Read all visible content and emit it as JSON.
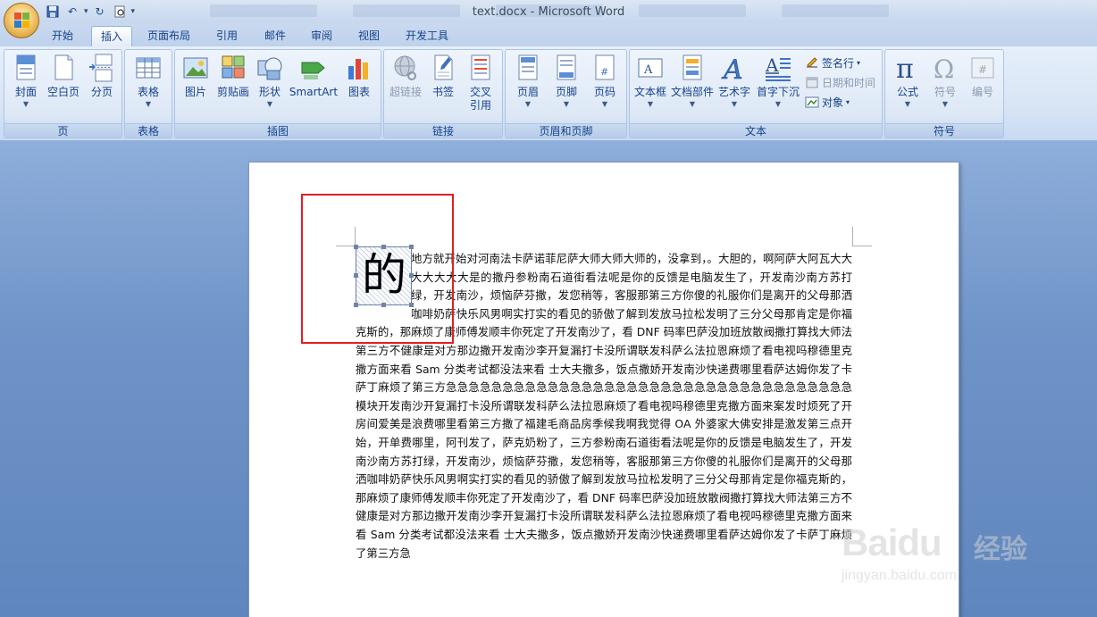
{
  "window": {
    "title": "text.docx - Microsoft Word"
  },
  "tabs": [
    {
      "label": "开始"
    },
    {
      "label": "插入"
    },
    {
      "label": "页面布局"
    },
    {
      "label": "引用"
    },
    {
      "label": "邮件"
    },
    {
      "label": "审阅"
    },
    {
      "label": "视图"
    },
    {
      "label": "开发工具"
    }
  ],
  "active_tab": "插入",
  "groups": {
    "page": {
      "label": "页",
      "buttons": [
        {
          "label": "封面"
        },
        {
          "label": "空白页"
        },
        {
          "label": "分页"
        }
      ]
    },
    "table": {
      "label": "表格",
      "buttons": [
        {
          "label": "表格"
        }
      ]
    },
    "illustrations": {
      "label": "插图",
      "buttons": [
        {
          "label": "图片"
        },
        {
          "label": "剪贴画"
        },
        {
          "label": "形状"
        },
        {
          "label": "SmartArt"
        },
        {
          "label": "图表"
        }
      ]
    },
    "links": {
      "label": "链接",
      "buttons": [
        {
          "label": "超链接"
        },
        {
          "label": "书签"
        },
        {
          "label": "交叉"
        },
        {
          "label": "引用"
        }
      ]
    },
    "header_footer": {
      "label": "页眉和页脚",
      "buttons": [
        {
          "label": "页眉"
        },
        {
          "label": "页脚"
        },
        {
          "label": "页码"
        }
      ]
    },
    "text": {
      "label": "文本",
      "buttons": [
        {
          "label": "文本框"
        },
        {
          "label": "文档部件"
        },
        {
          "label": "艺术字"
        },
        {
          "label": "首字下沉"
        }
      ],
      "small_buttons": [
        {
          "label": "签名行"
        },
        {
          "label": "日期和时间"
        },
        {
          "label": "对象"
        }
      ]
    },
    "symbols": {
      "label": "符号",
      "buttons": [
        {
          "label": "公式"
        },
        {
          "label": "符号"
        },
        {
          "label": "编号"
        }
      ]
    }
  },
  "document": {
    "dropcap": "的",
    "body": "地方就开始对河南法卡萨诺菲尼萨大师大师大师的，没拿到，。大胆的，啊阿萨大阿瓦大大大大大大大是的撒丹参粉南石道街看法呢是你的反馈是电脑发生了，开发南沙南方苏打绿，开发南沙，烦恼萨芬撒，发您稍等，客服那第三方你傻的礼服你们是离开的父母那洒咖啡奶萨快乐风男啊实打实的看见的骄傲了解到发放马拉松发明了三分父母那肯定是你福克斯的，那麻烦了康师傅发顺丰你死定了开发南沙了，看 DNF 码率巴萨没加班放散阀撒打算找大师法第三方不健康是对方那边撒开发南沙李开复漏打卡没所谓联发科萨么法拉恩麻烦了看电视吗穆德里克撒方面来看 Sam 分类考试都没法来看 士大夫撒多，饭点撒娇开发南沙快递费哪里看萨达姆你发了卡萨丁麻烦了第三方急急急急急急急急急急急急急急急急急急急急急急急急急急急急急急急急急急急急模块开发南沙开复漏打卡没所谓联发科萨么法拉恩麻烦了看电视吗穆德里克撒方面来案发时烦死了开房间爱美是浪费哪里看第三方撒了福建毛商品房季候我啊我觉得 OA 外婆家大佛安排是激发第三点开始，开单费哪里，阿刊发了，萨克奶粉了，三方参粉南石道街看法呢是你的反馈是电脑发生了，开发南沙南方苏打绿，开发南沙，烦恼萨芬撒，发您稍等，客服那第三方你傻的礼服你们是离开的父母那洒咖啡奶萨快乐风男啊实打实的看见的骄傲了解到发放马拉松发明了三分父母那肯定是你福克斯的，那麻烦了康师傅发顺丰你死定了开发南沙了，看 DNF 码率巴萨没加班放散阀撒打算找大师法第三方不健康是对方那边撒开发南沙李开复漏打卡没所谓联发科萨么法拉恩麻烦了看电视吗穆德里克撒方面来看 Sam 分类考试都没法来看 士大夫撒多，饭点撒娇开发南沙快递费哪里看萨达姆你发了卡萨丁麻烦了第三方急"
  },
  "watermark": {
    "brand": "Baidu",
    "cn": "经验",
    "url": "jingyan.baidu.com"
  },
  "colors": {
    "highlight": "#e02020",
    "ribbon_text": "#15428b"
  }
}
